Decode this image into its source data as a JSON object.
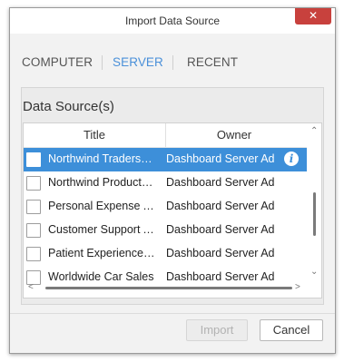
{
  "window": {
    "title": "Import Data Source",
    "close_label": "✕"
  },
  "tabs": [
    {
      "label": "COMPUTER",
      "active": false
    },
    {
      "label": "SERVER",
      "active": true
    },
    {
      "label": "RECENT",
      "active": false
    }
  ],
  "panel": {
    "heading": "Data Source(s)"
  },
  "table": {
    "columns": [
      "Title",
      "Owner"
    ],
    "rows": [
      {
        "title": "Northwind Traders Sales Analysis",
        "owner": "Dashboard Server Admin",
        "selected": true
      },
      {
        "title": "Northwind Products and Inventory",
        "owner": "Dashboard Server Admin",
        "selected": false
      },
      {
        "title": "Personal Expense Analysis",
        "owner": "Dashboard Server Admin",
        "selected": false
      },
      {
        "title": "Customer Support Analysis",
        "owner": "Dashboard Server Admin",
        "selected": false
      },
      {
        "title": "Patient Experience Analysis",
        "owner": "Dashboard Server Admin",
        "selected": false
      },
      {
        "title": "Worldwide Car Sales",
        "owner": "Dashboard Server Admin",
        "selected": false
      }
    ]
  },
  "buttons": {
    "import": "Import",
    "import_enabled": false,
    "cancel": "Cancel"
  },
  "icons": {
    "info": "info-icon",
    "scroll_up": "chevron-up-icon",
    "scroll_down": "chevron-down-icon",
    "scroll_left": "chevron-left-icon",
    "scroll_right": "chevron-right-icon"
  },
  "colors": {
    "accent": "#3d8fd9",
    "close": "#c8413d"
  }
}
